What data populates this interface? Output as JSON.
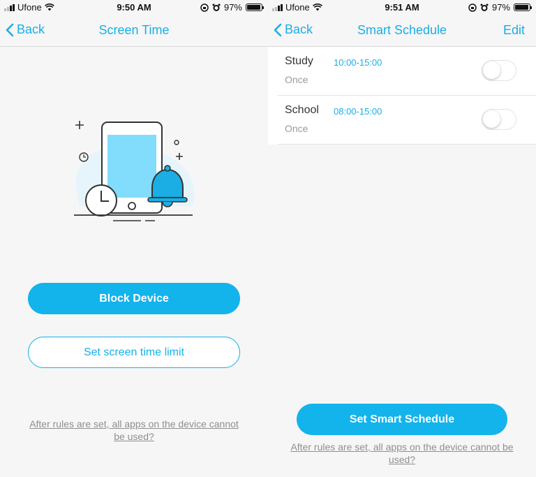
{
  "colors": {
    "accent": "#13b3ec",
    "link": "#1aaee5",
    "note": "#8f8f8f"
  },
  "left": {
    "status": {
      "carrier": "Ufone",
      "time": "9:50 AM",
      "battery": "97%",
      "battery_level": 0.97
    },
    "nav": {
      "back_label": "Back",
      "title": "Screen Time"
    },
    "block_button": "Block Device",
    "limit_button": "Set screen time limit",
    "note": "After  rules are set, all apps on the device cannot be used?"
  },
  "right": {
    "status": {
      "carrier": "Ufone",
      "time": "9:51 AM",
      "battery": "97%",
      "battery_level": 0.97
    },
    "nav": {
      "back_label": "Back",
      "title": "Smart Schedule",
      "edit_label": "Edit"
    },
    "schedules": [
      {
        "name": "Study",
        "time": "10:00-15:00",
        "frequency": "Once",
        "enabled": false
      },
      {
        "name": "School",
        "time": "08:00-15:00",
        "frequency": "Once",
        "enabled": false
      }
    ],
    "set_button": "Set Smart Schedule",
    "note": "After  rules are set, all apps on the device cannot be used?"
  }
}
